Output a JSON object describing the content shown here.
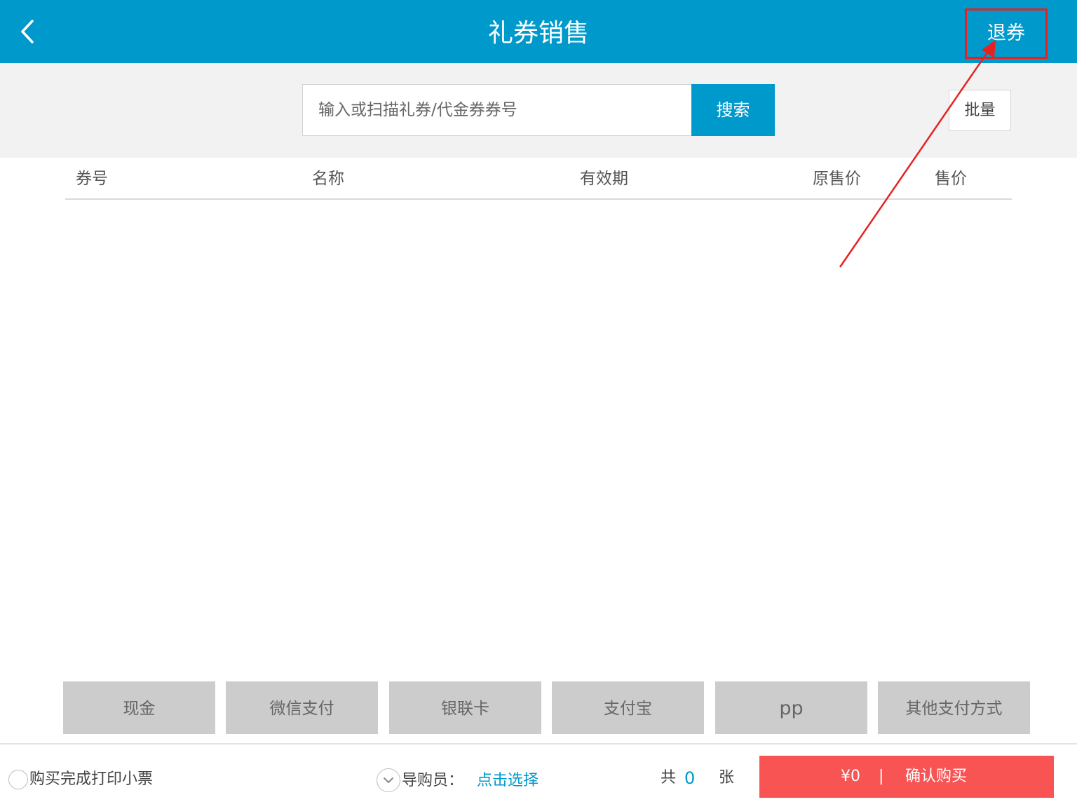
{
  "header": {
    "title": "礼券销售",
    "refund_label": "退券"
  },
  "search": {
    "placeholder": "输入或扫描礼券/代金券券号",
    "button_label": "搜索",
    "batch_label": "批量"
  },
  "table": {
    "columns": [
      "券号",
      "名称",
      "有效期",
      "原售价",
      "售价"
    ]
  },
  "payments": [
    "现金",
    "微信支付",
    "银联卡",
    "支付宝",
    "pp",
    "其他支付方式"
  ],
  "footer": {
    "print_receipt_label": "购买完成打印小票",
    "guide_label": "导购员：",
    "guide_select_label": "点击选择",
    "count_prefix": "共",
    "count_value": "0",
    "count_suffix": "张",
    "total_amount": "¥0",
    "separator": "|",
    "confirm_label": "确认购买"
  },
  "colors": {
    "header_bg": "#0099cc",
    "accent": "#0099cc",
    "confirm_bg": "#f85454",
    "annotation_red": "#e52222"
  },
  "icons": {
    "back": "chevron-left-icon",
    "guide_dropdown": "chevron-down-icon"
  }
}
